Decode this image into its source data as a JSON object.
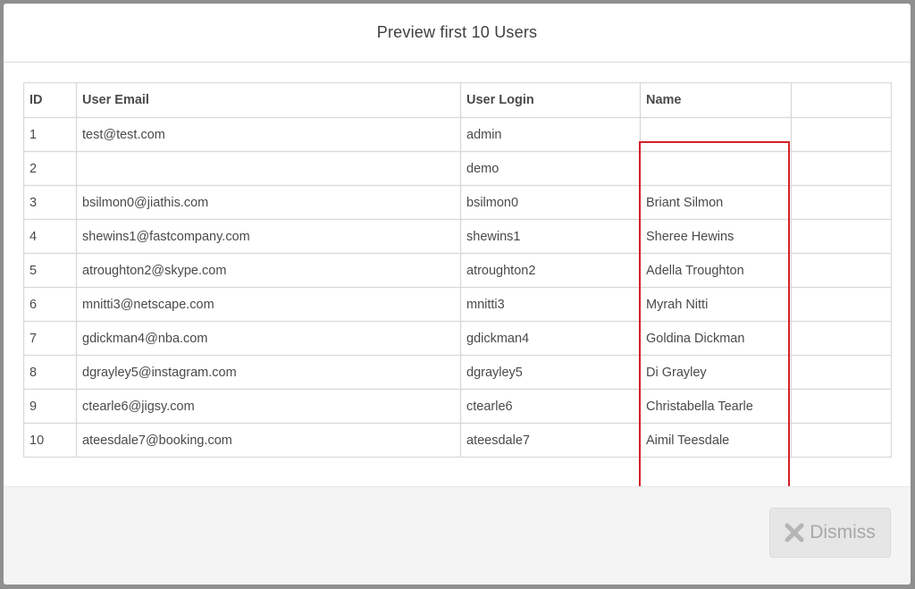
{
  "modal": {
    "title": "Preview first 10 Users"
  },
  "table": {
    "headers": {
      "id": "ID",
      "email": "User Email",
      "login": "User Login",
      "name": "Name",
      "extra": ""
    },
    "rows": [
      {
        "id": "1",
        "email": "test@test.com",
        "login": "admin",
        "name": ""
      },
      {
        "id": "2",
        "email": "",
        "login": "demo",
        "name": ""
      },
      {
        "id": "3",
        "email": "bsilmon0@jiathis.com",
        "login": "bsilmon0",
        "name": "Briant Silmon"
      },
      {
        "id": "4",
        "email": "shewins1@fastcompany.com",
        "login": "shewins1",
        "name": "Sheree Hewins"
      },
      {
        "id": "5",
        "email": "atroughton2@skype.com",
        "login": "atroughton2",
        "name": "Adella Troughton"
      },
      {
        "id": "6",
        "email": "mnitti3@netscape.com",
        "login": "mnitti3",
        "name": "Myrah Nitti"
      },
      {
        "id": "7",
        "email": "gdickman4@nba.com",
        "login": "gdickman4",
        "name": "Goldina Dickman"
      },
      {
        "id": "8",
        "email": "dgrayley5@instagram.com",
        "login": "dgrayley5",
        "name": "Di Grayley"
      },
      {
        "id": "9",
        "email": "ctearle6@jigsy.com",
        "login": "ctearle6",
        "name": "Christabella Tearle"
      },
      {
        "id": "10",
        "email": "ateesdale7@booking.com",
        "login": "ateesdale7",
        "name": "Aimil Teesdale"
      }
    ]
  },
  "footer": {
    "dismiss_label": "Dismiss",
    "dismiss_icon": "close-icon"
  },
  "colors": {
    "highlight": "#d42027",
    "button_bg": "#e6e6e6",
    "button_text": "#a8a8a8"
  }
}
